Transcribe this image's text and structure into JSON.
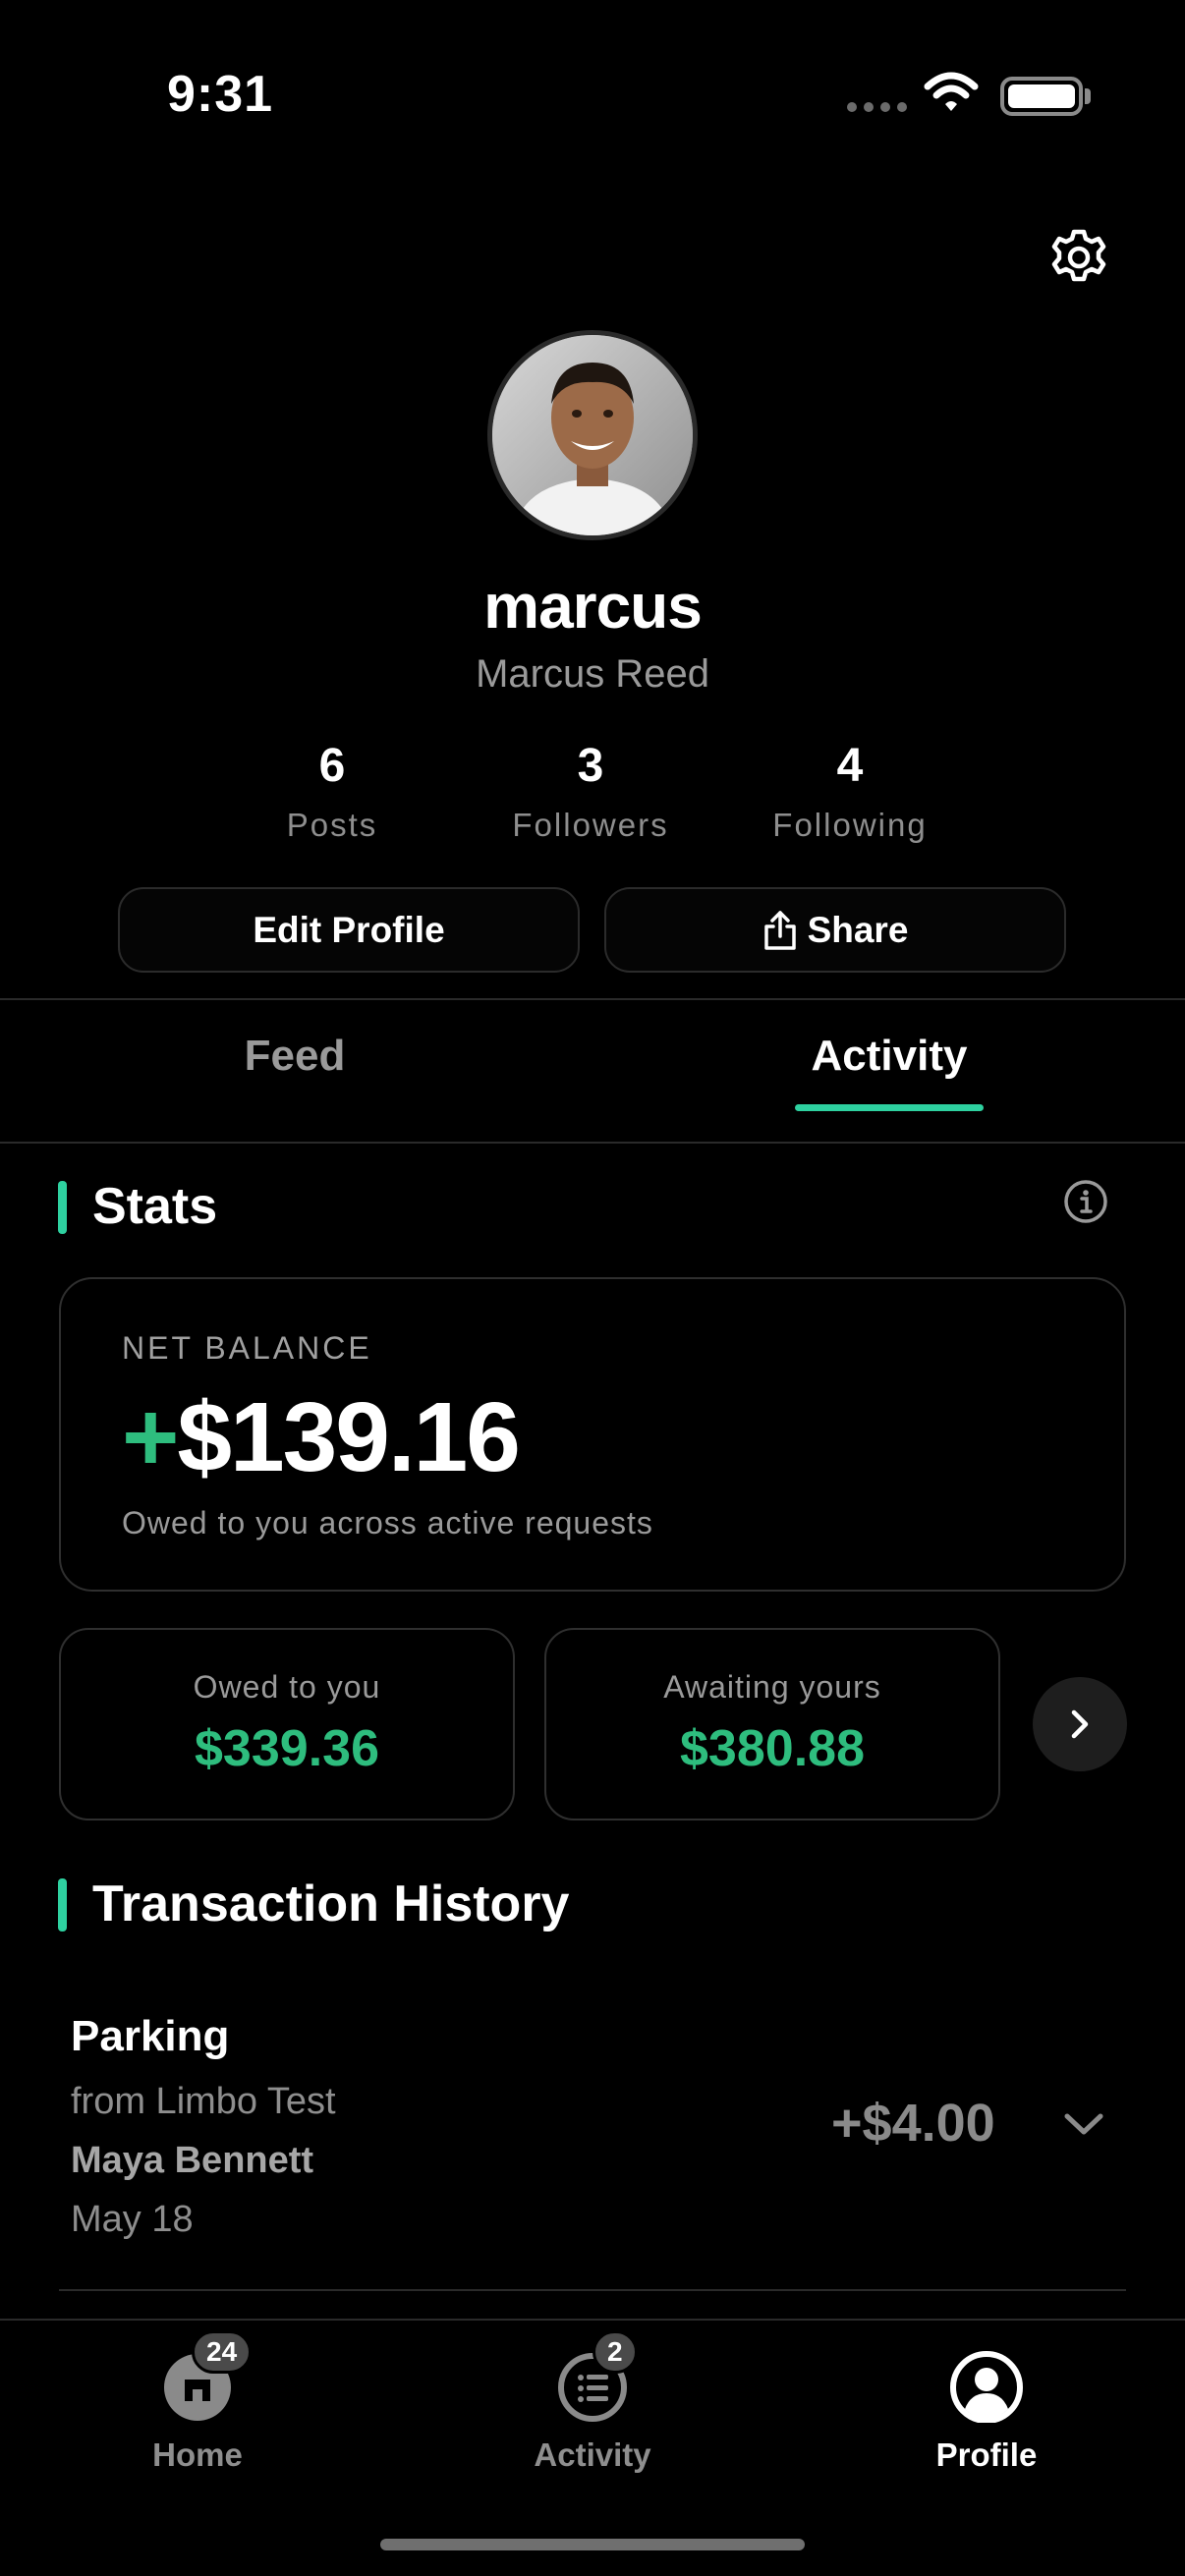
{
  "status_bar": {
    "time": "9:31"
  },
  "profile": {
    "username": "marcus",
    "full_name": "Marcus Reed",
    "stats": [
      {
        "value": "6",
        "label": "Posts"
      },
      {
        "value": "3",
        "label": "Followers"
      },
      {
        "value": "4",
        "label": "Following"
      }
    ],
    "edit_label": "Edit Profile",
    "share_label": "Share"
  },
  "tabs": [
    {
      "label": "Feed",
      "active": false
    },
    {
      "label": "Activity",
      "active": true
    }
  ],
  "stats_section": {
    "title": "Stats",
    "net_balance_label": "NET BALANCE",
    "net_balance_sign": "+",
    "net_balance_value": "$139.16",
    "net_balance_sub": "Owed to you across active requests",
    "owed_to_you_label": "Owed to you",
    "owed_to_you_value": "$339.36",
    "awaiting_label": "Awaiting yours",
    "awaiting_value": "$380.88"
  },
  "transactions": {
    "title": "Transaction History",
    "items": [
      {
        "title": "Parking",
        "group": "from Limbo Test",
        "person": "Maya Bennett",
        "date": "May 18",
        "amount": "+$4.00"
      }
    ]
  },
  "nav": [
    {
      "label": "Home",
      "badge": "24",
      "icon": "home-icon",
      "active": false
    },
    {
      "label": "Activity",
      "badge": "2",
      "icon": "activity-list-icon",
      "active": false
    },
    {
      "label": "Profile",
      "badge": "",
      "icon": "profile-icon",
      "active": true
    }
  ],
  "colors": {
    "accent": "#2ed1a0",
    "money_green": "#2ebd7e",
    "background": "#000000"
  }
}
